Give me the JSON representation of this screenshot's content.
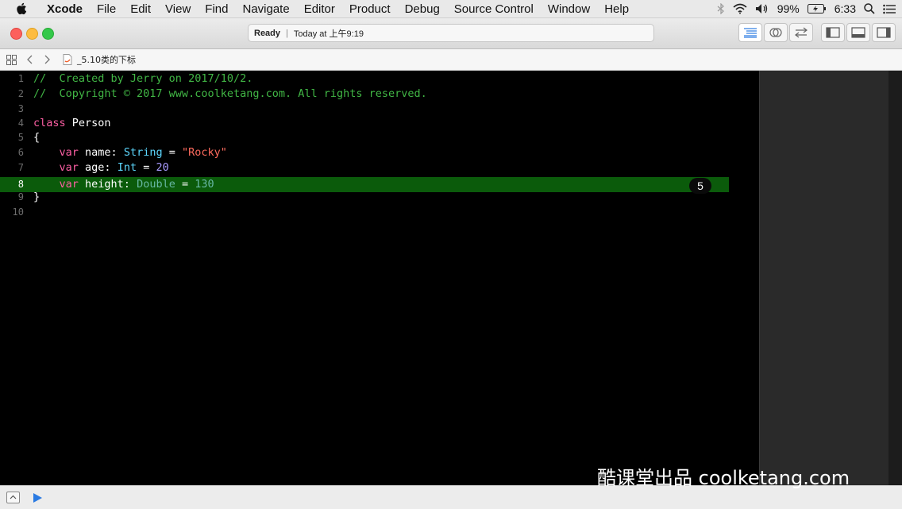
{
  "menubar": {
    "items": [
      "Xcode",
      "File",
      "Edit",
      "View",
      "Find",
      "Navigate",
      "Editor",
      "Product",
      "Debug",
      "Source Control",
      "Window",
      "Help"
    ],
    "battery": "99%",
    "time": "6:33"
  },
  "titlebar": {
    "status": "Ready",
    "timestamp": "Today at 上午9:19"
  },
  "jumpbar": {
    "file": "_5.10类的下标"
  },
  "editor": {
    "lines": [
      {
        "n": "1",
        "tokens": [
          {
            "t": "//  Created by Jerry on 2017/10/2.",
            "c": "comment"
          }
        ]
      },
      {
        "n": "2",
        "tokens": [
          {
            "t": "//  Copyright © 2017 www.coolketang.com. All rights reserved.",
            "c": "comment"
          }
        ]
      },
      {
        "n": "3",
        "tokens": []
      },
      {
        "n": "4",
        "tokens": [
          {
            "t": "class",
            "c": "kw"
          },
          {
            "t": " Person",
            "c": "pl"
          }
        ]
      },
      {
        "n": "5",
        "tokens": [
          {
            "t": "{",
            "c": "pl"
          }
        ]
      },
      {
        "n": "6",
        "tokens": [
          {
            "t": "    ",
            "c": "pl"
          },
          {
            "t": "var",
            "c": "kw"
          },
          {
            "t": " name: ",
            "c": "pl"
          },
          {
            "t": "String",
            "c": "type"
          },
          {
            "t": " = ",
            "c": "pl"
          },
          {
            "t": "\"Rocky\"",
            "c": "str"
          }
        ]
      },
      {
        "n": "7",
        "tokens": [
          {
            "t": "    ",
            "c": "pl"
          },
          {
            "t": "var",
            "c": "kw"
          },
          {
            "t": " age: ",
            "c": "pl"
          },
          {
            "t": "Int",
            "c": "type"
          },
          {
            "t": " = ",
            "c": "pl"
          },
          {
            "t": "20",
            "c": "num"
          }
        ]
      },
      {
        "n": "8",
        "tokens": [
          {
            "t": "    ",
            "c": "pl"
          },
          {
            "t": "var",
            "c": "kw"
          },
          {
            "t": " height: ",
            "c": "pl"
          },
          {
            "t": "Double",
            "c": "type2"
          },
          {
            "t": " = ",
            "c": "pl"
          },
          {
            "t": "130",
            "c": "type2"
          }
        ]
      },
      {
        "n": "9",
        "tokens": [
          {
            "t": "}",
            "c": "pl"
          }
        ]
      },
      {
        "n": "10",
        "tokens": []
      }
    ],
    "highlighted_line": "8",
    "badge": "5"
  },
  "watermark": "酷课堂出品 coolketang.com"
}
